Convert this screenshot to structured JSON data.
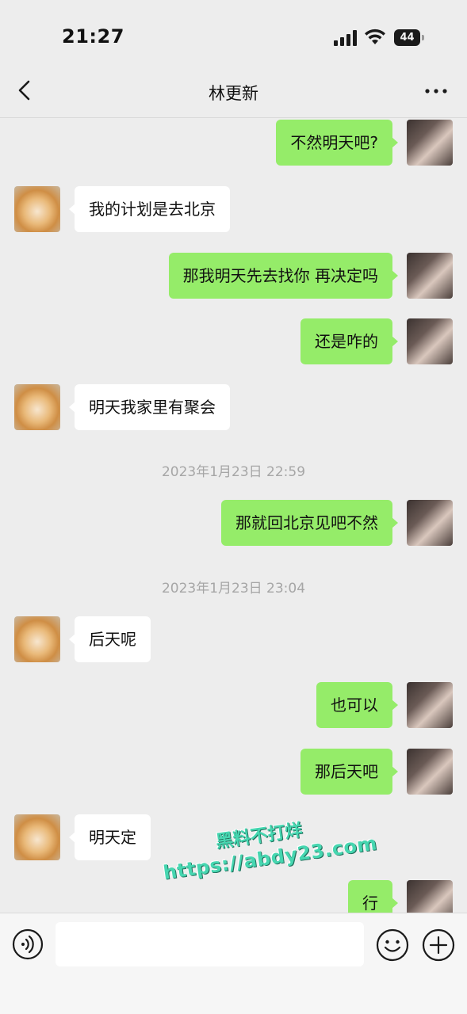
{
  "status_bar": {
    "time": "21:27",
    "battery": "44",
    "icons": [
      "signal-icon",
      "wifi-icon",
      "battery-icon"
    ]
  },
  "header": {
    "title": "林更新",
    "icons": [
      "back-chevron-icon",
      "more-icon"
    ]
  },
  "messages": [
    {
      "sender": "me",
      "text": "不然明天吧?"
    },
    {
      "sender": "other",
      "text": "我的计划是去北京"
    },
    {
      "sender": "me",
      "text": "那我明天先去找你 再决定吗"
    },
    {
      "sender": "me",
      "text": "还是咋的"
    },
    {
      "sender": "other",
      "text": "明天我家里有聚会"
    },
    {
      "timestamp": "2023年1月23日 22:59"
    },
    {
      "sender": "me",
      "text": "那就回北京见吧不然"
    },
    {
      "timestamp": "2023年1月23日 23:04"
    },
    {
      "sender": "other",
      "text": "后天呢"
    },
    {
      "sender": "me",
      "text": "也可以"
    },
    {
      "sender": "me",
      "text": "那后天吧"
    },
    {
      "sender": "other",
      "text": "明天定"
    },
    {
      "sender": "me",
      "text": "行"
    }
  ],
  "watermark": {
    "line1": "黑料不打烊",
    "line2": "https://abdy23.com"
  },
  "input_bar": {
    "text_value": "",
    "icons": [
      "voice-icon",
      "emoji-icon",
      "plus-icon"
    ]
  },
  "colors": {
    "background": "#ededed",
    "my_bubble": "#95ec69",
    "their_bubble": "#ffffff",
    "timestamp_text": "#a6a6a6"
  }
}
